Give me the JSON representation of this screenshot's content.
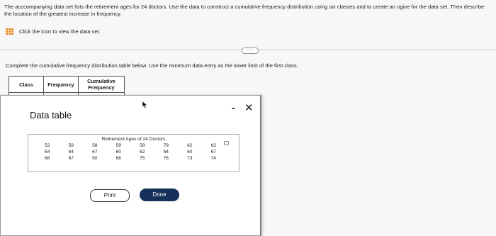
{
  "question": {
    "text": "The acccompanying data set lists the retirement ages for 24 doctors. Use the data to construct a cumulative frequency distribution using six classes and to create an ogive for the data set. Then describe the location of the greatest increase in frequency."
  },
  "data_link": {
    "icon": "grid-icon",
    "label": "Click the icon to view the data set."
  },
  "expand_handle": {
    "label": "....."
  },
  "instruction": "Complete the cumulative frequency distribution table below. Use the minimum data entry as the lower limit of the first class.",
  "answer_table": {
    "headers": [
      "Class",
      "Frequency",
      "Cumulative",
      "Frequency"
    ]
  },
  "modal": {
    "title": "Data table",
    "minimize": "-",
    "close": "✕",
    "caption": "Retirement Ages of 24 Doctors",
    "ages": [
      [
        "52",
        "59",
        "58",
        "59",
        "58",
        "79",
        "62",
        "62"
      ],
      [
        "64",
        "64",
        "67",
        "60",
        "62",
        "64",
        "60",
        "67"
      ],
      [
        "66",
        "67",
        "50",
        "66",
        "75",
        "76",
        "73",
        "74"
      ]
    ],
    "print_label": "Print",
    "done_label": "Done",
    "done_color": "#15305a"
  }
}
